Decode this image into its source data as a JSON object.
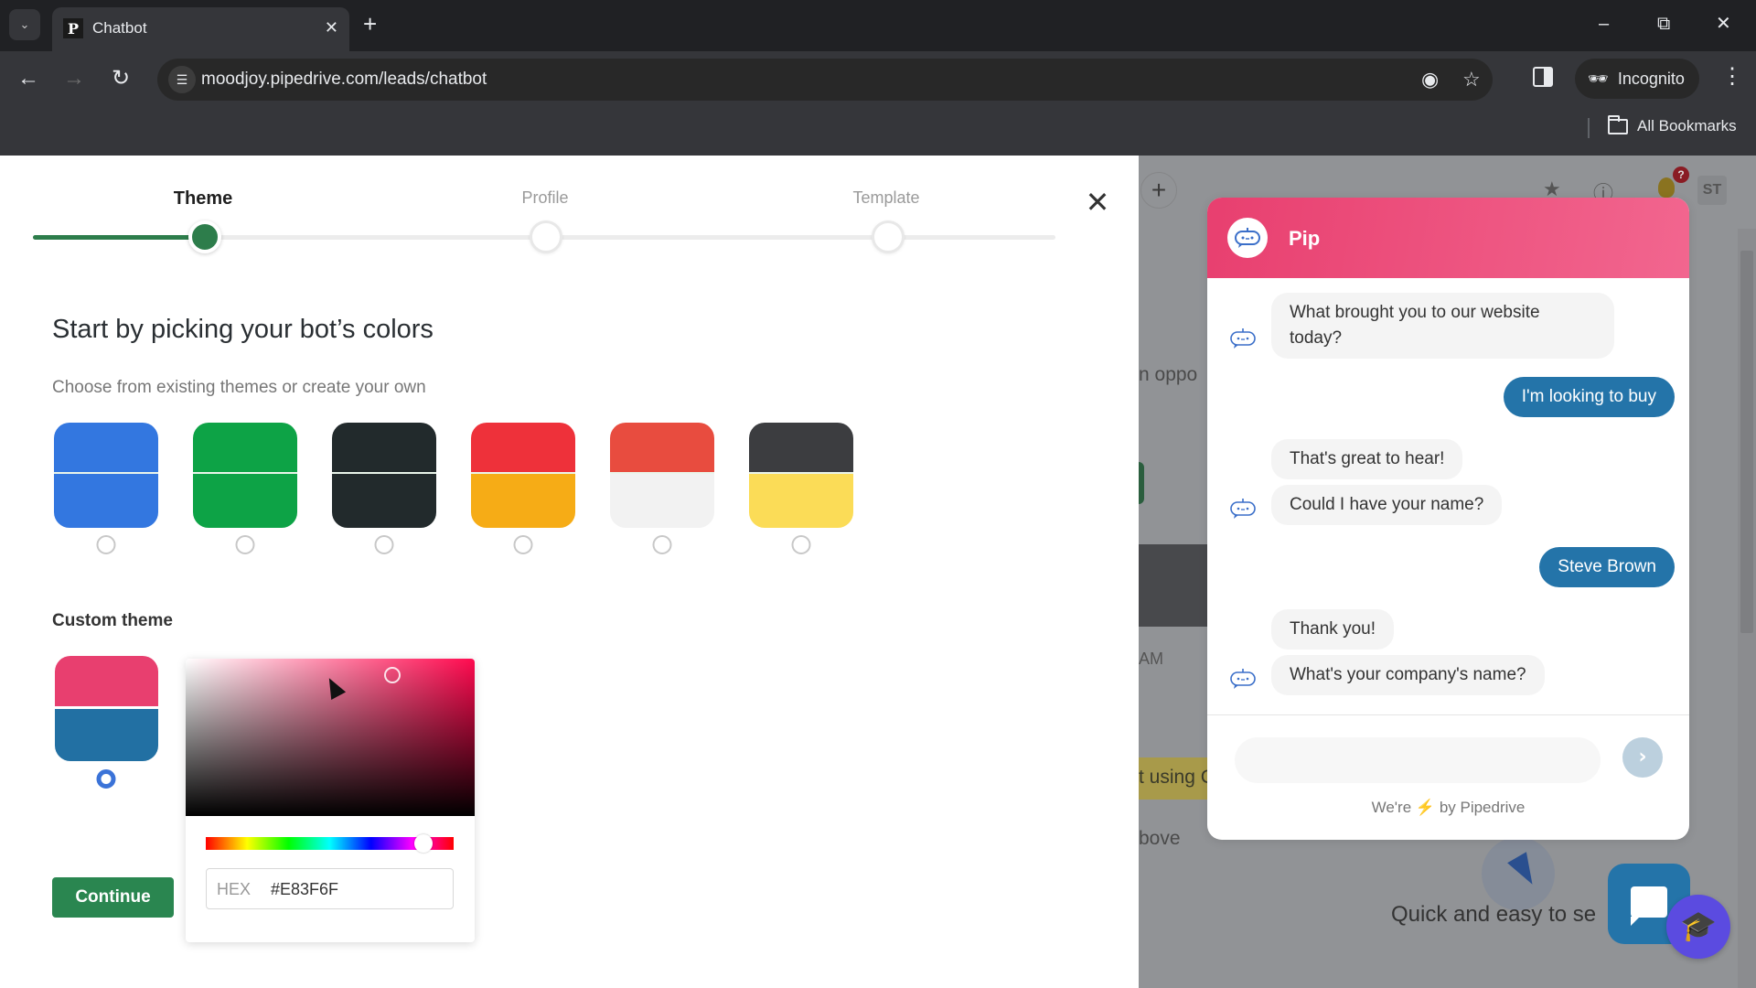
{
  "browser": {
    "tab_title": "Chatbot",
    "tab_favicon": "P",
    "url": "moodjoy.pipedrive.com/leads/chatbot",
    "incognito_label": "Incognito",
    "bookmarks_label": "All Bookmarks"
  },
  "wizard": {
    "steps": [
      {
        "label": "Theme",
        "state": "active"
      },
      {
        "label": "Profile",
        "state": "pending"
      },
      {
        "label": "Template",
        "state": "pending"
      }
    ],
    "progress_fraction": 0.17,
    "heading": "Start by picking your bot’s colors",
    "subheading": "Choose from existing themes or create your own",
    "themes": [
      {
        "name": "blue",
        "primary": "#3377E0",
        "secondary": "#3377E0",
        "selected": false
      },
      {
        "name": "green",
        "primary": "#0DA346",
        "secondary": "#0DA346",
        "selected": false
      },
      {
        "name": "dark",
        "primary": "#222A2C",
        "secondary": "#222A2C",
        "selected": false
      },
      {
        "name": "red-orange",
        "primary": "#EE313A",
        "secondary": "#F6AC16",
        "selected": false
      },
      {
        "name": "coral-light",
        "primary": "#E84C3F",
        "secondary": "#F2F2F2",
        "selected": false
      },
      {
        "name": "charcoal-yellow",
        "primary": "#3C3D40",
        "secondary": "#FBDC57",
        "selected": false
      }
    ],
    "custom_theme_label": "Custom theme",
    "custom_theme": {
      "primary": "#E83F6F",
      "secondary": "#2270A3",
      "selected": true
    },
    "color_picker": {
      "hex_label": "HEX",
      "hex_value": "#E83F6F",
      "hue_base": "#FF0A4F"
    },
    "continue_label": "Continue",
    "close_label": "✕"
  },
  "background_app": {
    "fragments": [
      "n oppo",
      "AM",
      "t using C",
      "bove"
    ],
    "quick_text": "Quick and easy to se",
    "avatar_initials": "ST",
    "notification_count": "?"
  },
  "chat_preview": {
    "bot_name": "Pip",
    "header_color": "#E83F6F",
    "user_bubble_color": "#2474A9",
    "messages": [
      {
        "from": "bot",
        "text": "What brought you to our website today?"
      },
      {
        "from": "user",
        "text": "I'm looking to buy"
      },
      {
        "from": "bot",
        "text": "That's great to hear!"
      },
      {
        "from": "bot",
        "text": "Could I have your name?"
      },
      {
        "from": "user",
        "text": "Steve Brown"
      },
      {
        "from": "bot",
        "text": "Thank you!"
      },
      {
        "from": "bot",
        "text": "What's your company's name?"
      }
    ],
    "input_placeholder": "",
    "footer_prefix": "We're",
    "footer_bolt": "⚡",
    "footer_suffix": "by Pipedrive"
  }
}
